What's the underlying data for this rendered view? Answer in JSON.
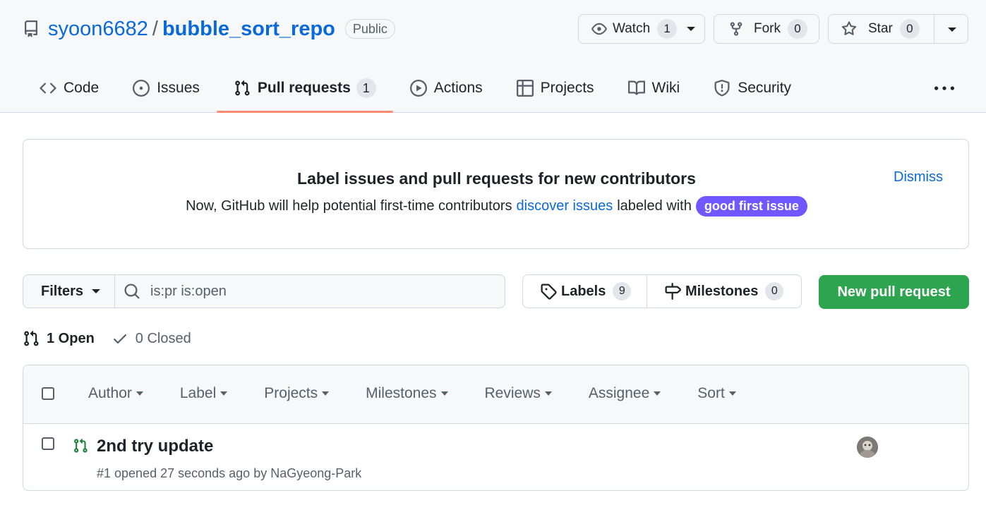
{
  "repo": {
    "owner": "syoon6682",
    "separator": "/",
    "name": "bubble_sort_repo",
    "visibility": "Public"
  },
  "header_buttons": {
    "watch": {
      "label": "Watch",
      "count": "1"
    },
    "fork": {
      "label": "Fork",
      "count": "0"
    },
    "star": {
      "label": "Star",
      "count": "0"
    }
  },
  "tabs": [
    {
      "label": "Code",
      "icon": "code-icon"
    },
    {
      "label": "Issues",
      "icon": "issue-opened-icon"
    },
    {
      "label": "Pull requests",
      "icon": "git-pull-request-icon",
      "count": "1",
      "selected": true
    },
    {
      "label": "Actions",
      "icon": "play-icon"
    },
    {
      "label": "Projects",
      "icon": "table-icon"
    },
    {
      "label": "Wiki",
      "icon": "book-icon"
    },
    {
      "label": "Security",
      "icon": "shield-icon"
    }
  ],
  "banner": {
    "title": "Label issues and pull requests for new contributors",
    "text_before": "Now, GitHub will help potential first-time contributors",
    "link": "discover issues",
    "text_after": "labeled with",
    "label_badge": "good first issue",
    "dismiss": "Dismiss"
  },
  "filters": {
    "button": "Filters",
    "search_value": "is:pr is:open",
    "labels_label": "Labels",
    "labels_count": "9",
    "milestones_label": "Milestones",
    "milestones_count": "0",
    "new_pr": "New pull request"
  },
  "states": {
    "open": "1 Open",
    "closed": "0 Closed"
  },
  "list_header": {
    "filters": [
      "Author",
      "Label",
      "Projects",
      "Milestones",
      "Reviews",
      "Assignee",
      "Sort"
    ]
  },
  "pull_requests": [
    {
      "title": "2nd try update",
      "meta": "#1 opened 27 seconds ago by NaGyeong-Park"
    }
  ],
  "colors": {
    "accent_link": "#0969da",
    "tab_underline": "#fd8c73",
    "good_first_issue": "#7057ff",
    "primary_button": "#2da44e",
    "pr_open": "#1a7f37"
  }
}
